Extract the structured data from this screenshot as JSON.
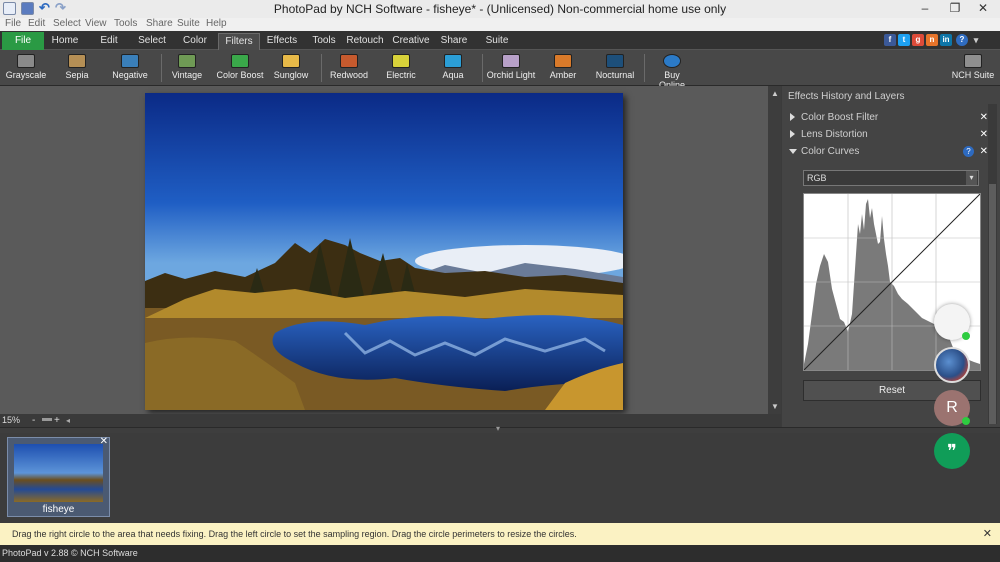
{
  "window": {
    "title": "PhotoPad by NCH Software - fisheye* - (Unlicensed) Non-commercial home use only",
    "minimize": "‒",
    "maximize": "❐",
    "close": "✕"
  },
  "menu": [
    "File",
    "Edit",
    "Select",
    "View",
    "Tools",
    "Share",
    "Suite",
    "Help"
  ],
  "tabs": [
    "File",
    "Home",
    "Edit",
    "Select",
    "Color",
    "Filters",
    "Effects",
    "Tools",
    "Retouch",
    "Creative",
    "Share",
    "Suite"
  ],
  "active_tab": "Filters",
  "social": {
    "facebook": "f",
    "twitter": "t",
    "gplus": "g",
    "nch": "n",
    "linkedin": "in",
    "help": "?"
  },
  "toolbar": [
    "Grayscale",
    "Sepia",
    "Negative",
    "Vintage",
    "Color Boost",
    "Sunglow",
    "Redwood",
    "Electric",
    "Aqua",
    "Orchid Light",
    "Amber",
    "Nocturnal",
    "Buy Online",
    "NCH Suite"
  ],
  "tool_colors": [
    "#8a8a8a",
    "#b58f55",
    "#3a7fb9",
    "#6f9a55",
    "#3aa84a",
    "#e7b948",
    "#c65a2e",
    "#d8d23a",
    "#2b9ed6",
    "#b7a0c8",
    "#d97a2a",
    "#1d4f7a",
    "#2b7ac7",
    "#8f8f8f"
  ],
  "zoom": {
    "level": "15%",
    "minus": "-",
    "plus": "+"
  },
  "panel": {
    "title": "Effects History and Layers",
    "layers": [
      {
        "label": "Color Boost Filter",
        "expanded": false
      },
      {
        "label": "Lens Distortion",
        "expanded": false
      },
      {
        "label": "Color Curves",
        "expanded": true
      }
    ],
    "channel": "RGB",
    "reset_label": "Reset"
  },
  "thumbnail": {
    "label": "fisheye"
  },
  "hint": "Drag the right circle to the area that needs fixing. Drag the left circle to set the sampling region. Drag the circle perimeters to resize the circles.",
  "status": "PhotoPad v 2.88 © NCH Software",
  "overlay": {
    "avatar_letter": "R",
    "chat_glyph": "❞"
  }
}
